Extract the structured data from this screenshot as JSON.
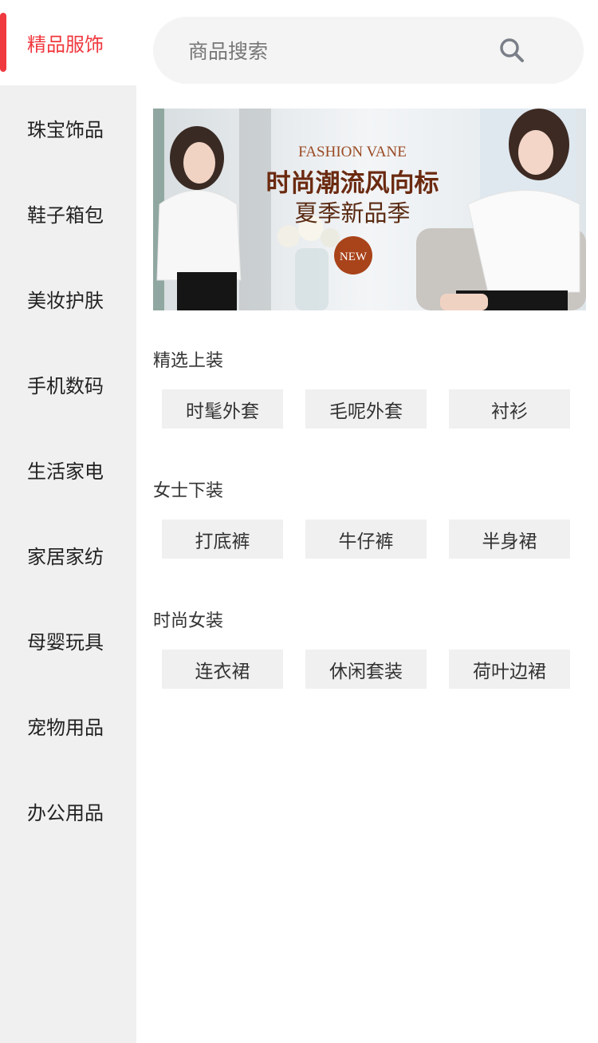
{
  "sidebar": {
    "items": [
      {
        "label": "精品服饰"
      },
      {
        "label": "珠宝饰品"
      },
      {
        "label": "鞋子箱包"
      },
      {
        "label": "美妆护肤"
      },
      {
        "label": "手机数码"
      },
      {
        "label": "生活家电"
      },
      {
        "label": "家居家纺"
      },
      {
        "label": "母婴玩具"
      },
      {
        "label": "宠物用品"
      },
      {
        "label": "办公用品"
      }
    ],
    "active_color": "#f0393f"
  },
  "search": {
    "placeholder": "商品搜索",
    "icon": "search-icon"
  },
  "banner": {
    "brand": "FASHION VANE",
    "headline": "时尚潮流风向标",
    "subline": "夏季新品季",
    "badge": "NEW"
  },
  "sections": [
    {
      "title": "精选上装",
      "tags": [
        "时髦外套",
        "毛呢外套",
        "衬衫"
      ]
    },
    {
      "title": "女士下装",
      "tags": [
        "打底裤",
        "牛仔裤",
        "半身裙"
      ]
    },
    {
      "title": "时尚女装",
      "tags": [
        "连衣裙",
        "休闲套装",
        "荷叶边裙"
      ]
    }
  ]
}
